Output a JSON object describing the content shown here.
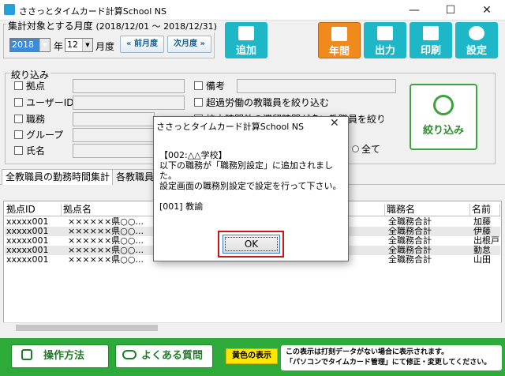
{
  "window": {
    "title": "ささっとタイムカード計算School NS",
    "minimize": "—",
    "maximize": "☐",
    "close": "✕"
  },
  "period": {
    "legend": "集計対象とする月度",
    "range": "(2018/12/01 〜 2018/12/31)",
    "year": "2018",
    "year_unit": "年",
    "month": "12",
    "month_unit": "月度",
    "prev_label": "« 前月度",
    "next_label": "次月度 »"
  },
  "toolbar": {
    "add": "追加",
    "yearly": "年間",
    "output": "出力",
    "print": "印刷",
    "settings": "設定"
  },
  "colors": {
    "accent_teal": "#1eb7c7",
    "accent_orange": "#f08a1c",
    "accent_green": "#2eaa3a",
    "highlight_red": "#d01414",
    "notice_yellow": "#ffe600"
  },
  "filter": {
    "legend": "絞り込み",
    "location": "拠点",
    "user_id": "ユーザーID",
    "job_type": "職務",
    "group": "グループ",
    "name": "氏名",
    "remarks": "備考",
    "overtime": "超過労働の教職員を絞り込む",
    "hidden_option": "校内時間外の滞留時間が多い教職員を絞り込む",
    "all_radio": "全て",
    "button_label": "絞り込み"
  },
  "tabs": [
    "全教職員の勤務時間集計",
    "各教職員"
  ],
  "grid": {
    "columns": [
      "拠点ID",
      "拠点名",
      "職務名",
      "名前"
    ],
    "rows": [
      {
        "id": "xxxxx001",
        "location": "××××××県○○...",
        "job": "全職務合計",
        "name": "加藤"
      },
      {
        "id": "xxxxx001",
        "location": "××××××県○○...",
        "job": "全職務合計",
        "name": "伊藤"
      },
      {
        "id": "xxxxx001",
        "location": "××××××県○○...",
        "job": "全職務合計",
        "name": "出根戸"
      },
      {
        "id": "xxxxx001",
        "location": "××××××県○○...",
        "job": "全職務合計",
        "name": "勤怠"
      },
      {
        "id": "xxxxx001",
        "location": "××××××県○○...",
        "job": "全職務合計",
        "name": "山田"
      }
    ]
  },
  "footer": {
    "manual": "操作方法",
    "faq": "よくある質問",
    "badge": "黄色の表示",
    "notice_line1": "この表示は打刻データがない場合に表示されます。",
    "notice_line2": "「パソコンでタイムカード管理」にて修正・変更してください。"
  },
  "dialog": {
    "title": "ささっとタイムカード計算School NS",
    "close": "✕",
    "line1": "【002:△△学校】",
    "line2": "以下の職務が「職務別設定」に追加されました。",
    "line3": "設定画面の職務別設定で設定を行って下さい。",
    "line4": "[001] 教諭",
    "ok": "OK"
  }
}
